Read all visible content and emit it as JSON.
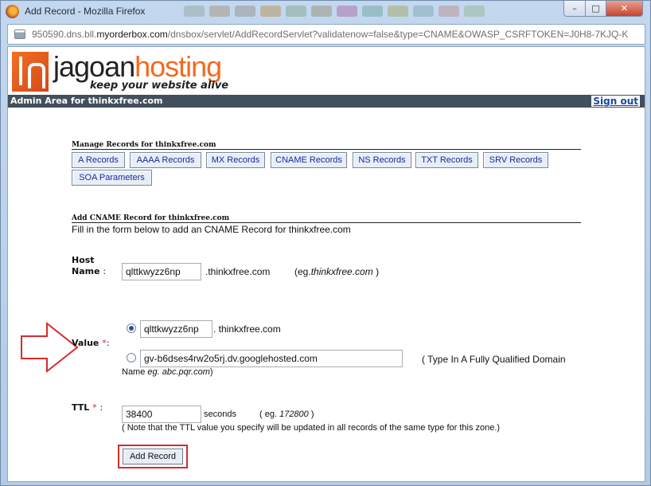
{
  "window": {
    "title": "Add Record - Mozilla Firefox",
    "url_prefix": "950590.dns.bll.",
    "url_host": "myorderbox.com",
    "url_rest": "/dnsbox/servlet/AddRecordServlet?validatenow=false&type=CNAME&OWASP_CSRFTOKEN=J0H8-7KJQ-K",
    "close_label": "✕",
    "max_label": "□",
    "min_label": "–"
  },
  "brand": {
    "name_part1": "jagoan",
    "name_part2": "hosting",
    "tagline": "keep your website alive",
    "color_orange": "#f26a1f"
  },
  "admin_bar": {
    "text": "Admin Area for thinkxfree.com",
    "signout_label": "Sign out"
  },
  "manage": {
    "heading": "Manage Records for thinkxfree.com",
    "buttons": [
      "A Records",
      "AAAA Records",
      "MX Records",
      "CNAME Records",
      "NS Records",
      "TXT Records",
      "SRV Records",
      "SOA Parameters"
    ]
  },
  "form": {
    "heading": "Add CNAME Record for thinkxfree.com",
    "intro": "Fill in the form below to add an CNAME Record for thinkxfree.com",
    "host_label_1": "Host",
    "host_label_2": "Name",
    "host_colon": ":",
    "host_value": "qlttkwyzz6np",
    "host_suffix": ".thinkxfree.com",
    "host_eg_prefix": "(eg.",
    "host_eg_example": "thinkxfree.com",
    "host_eg_suffix": ")",
    "value_label": "Value",
    "required_mark": "*",
    "value_colon": ":",
    "value_option1": "qlttkwyzz6np",
    "value_option1_suffix": ". thinkxfree.com",
    "value_option2": "gv-b6dses4rw2o5rj.dv.googlehosted.com",
    "value_option2_note": "( Type In A Fully Qualified Domain",
    "value_option2_note2_prefix": "Name",
    "value_option2_note2_example": "eg. abc.pqr.com",
    "value_option2_note2_suffix": ")",
    "ttl_label": "TTL",
    "ttl_colon": ":",
    "ttl_value": "38400",
    "ttl_unit": "seconds",
    "ttl_eg_prefix": "( eg.",
    "ttl_eg_example": "172800",
    "ttl_eg_suffix": ")",
    "ttl_note": "( Note that the TTL value you specify will be updated in all records of the same type for this zone.)",
    "submit_label": "Add Record"
  },
  "annotation_colors": {
    "highlight_red": "#d62b2b"
  }
}
